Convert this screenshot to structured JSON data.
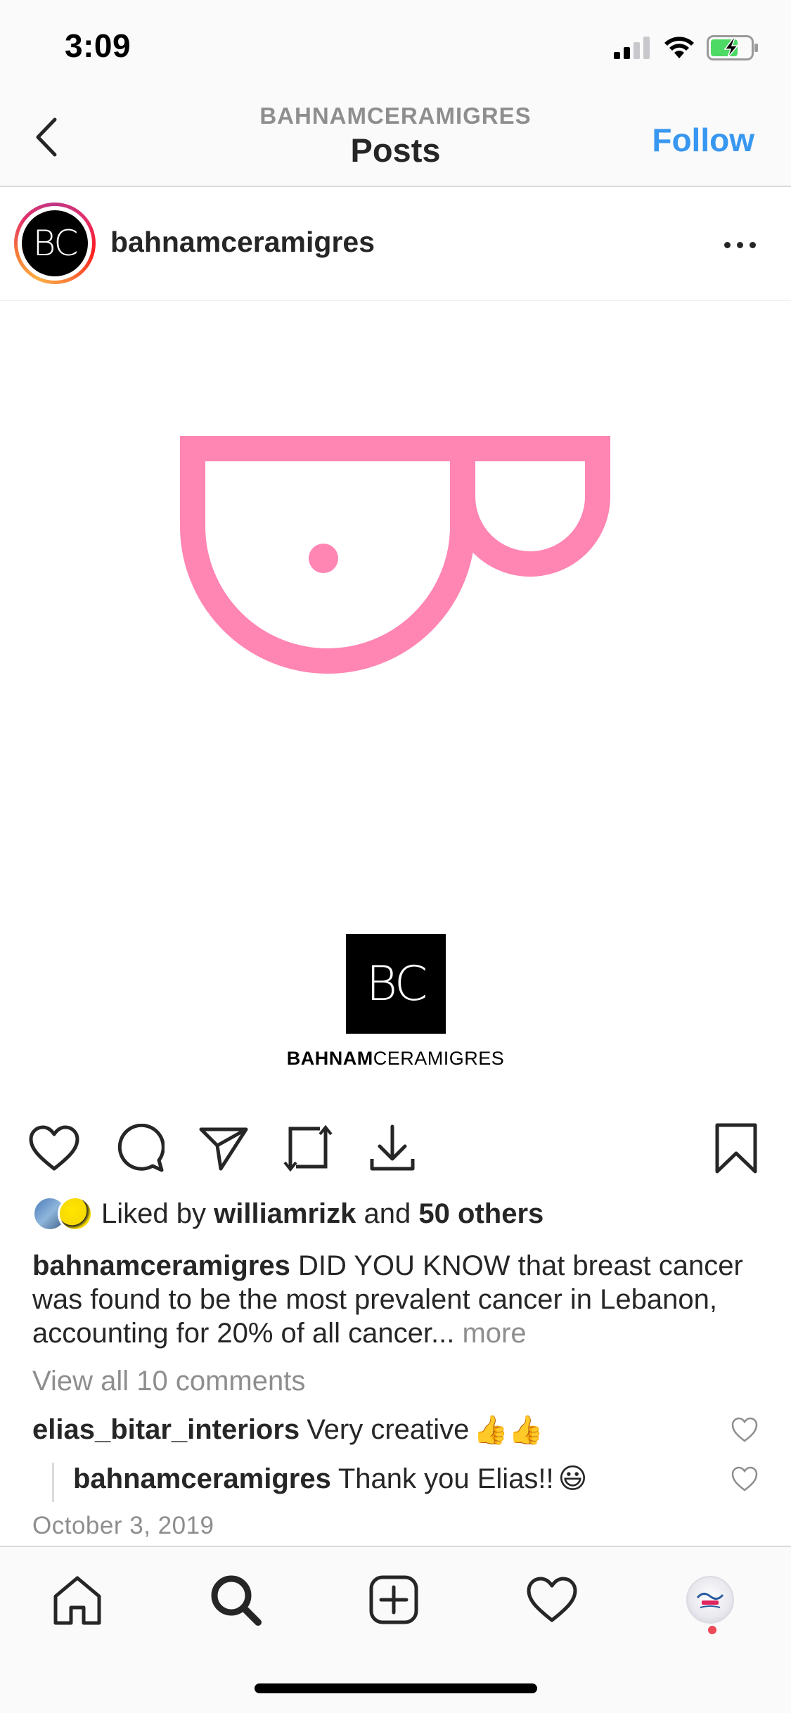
{
  "status_bar": {
    "time": "3:09"
  },
  "header": {
    "subtitle": "BAHNAMCERAMIGRES",
    "title": "Posts",
    "follow_label": "Follow",
    "accent_color": "#3897f0"
  },
  "post": {
    "username": "bahnamceramigres",
    "avatar_text": "BC",
    "image": {
      "logo_initials": "BC",
      "brand_bold": "BAHNAM",
      "brand_light": "CERAMIGRES",
      "motif_color": "#ff85b3"
    },
    "likes": {
      "prefix": "Liked by",
      "user": "williamrizk",
      "conj": "and",
      "others": "50 others"
    },
    "caption": {
      "username": "bahnamceramigres",
      "text": "DID YOU KNOW that breast cancer was found to be the most prevalent cancer in Lebanon, accounting for 20% of all cancer...",
      "more": "more"
    },
    "view_comments": "View all 10 comments",
    "comments": [
      {
        "username": "elias_bitar_interiors",
        "text": "Very creative",
        "emoji": "👍👍"
      },
      {
        "username": "bahnamceramigres",
        "text": "Thank you Elias!!",
        "emoji": "😃"
      }
    ],
    "date": "October 3, 2019"
  },
  "nav": {
    "items": [
      "home-icon",
      "search-icon",
      "add-post-icon",
      "activity-heart-icon",
      "profile-avatar"
    ],
    "notification_color": "#ed4956"
  }
}
